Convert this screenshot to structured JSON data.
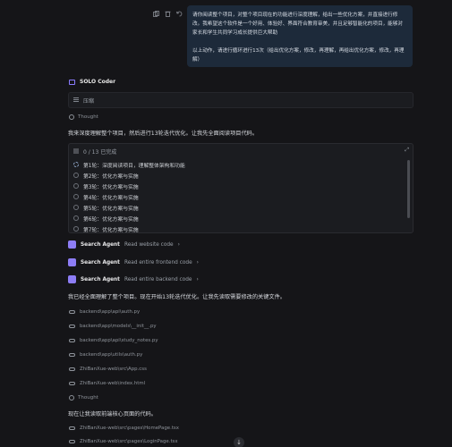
{
  "user_message": {
    "paragraph1": "请你阅读整个项目，对整个项目现在的功能进行深度理解，给出一些优化方案，并直接进行修改。我希望这个软件是一个好用、体验好、界面符合教育审美，并且足够智能化的项目，能够对家长和学生共同学习成长提供巨大帮助",
    "paragraph2": "以上动作，请进行循环进行13次（给出优化方案，修改，再理解，再给出优化方案，修改，再理解）"
  },
  "agent": {
    "name": "SOLO Coder"
  },
  "compress_label": "压缩",
  "thought_label": "Thought",
  "intro_text": "我来深度理解整个项目，然后进行13轮迭代优化。让我先全面阅读项目代码。",
  "task_panel": {
    "progress": "0 / 13 已完成",
    "items": [
      "第1轮：深度阅读项目，理解整体架构和功能",
      "第2轮：优化方案与实施",
      "第3轮：优化方案与实施",
      "第4轮：优化方案与实施",
      "第5轮：优化方案与实施",
      "第6轮：优化方案与实施",
      "第7轮：优化方案与实施"
    ]
  },
  "search_agents": [
    {
      "name": "Search Agent",
      "desc": "Read website code"
    },
    {
      "name": "Search Agent",
      "desc": "Read entire frontend code"
    },
    {
      "name": "Search Agent",
      "desc": "Read entire backend code"
    }
  ],
  "understood_text": "我已经全面理解了整个项目。现在开始13轮迭代优化。让我先读取需要修改的关键文件。",
  "files1": [
    "backend\\app\\api\\auth.py",
    "backend\\app\\models\\__init__.py",
    "backend\\app\\api\\study_notes.py",
    "backend\\app\\utils\\auth.py",
    "ZhiBanXue-web\\src\\App.css",
    "ZhiBanXue-web\\index.html"
  ],
  "thought2_label": "Thought",
  "next_text": "现在让我读取前端核心页面的代码。",
  "files2": [
    "ZhiBanXue-web\\src\\pages\\HomePage.tsx",
    "ZhiBanXue-web\\src\\pages\\LoginPage.tsx"
  ],
  "colors": {
    "bg": "#151518",
    "bubble": "#1d2a3a",
    "accent": "#8d7df5"
  }
}
